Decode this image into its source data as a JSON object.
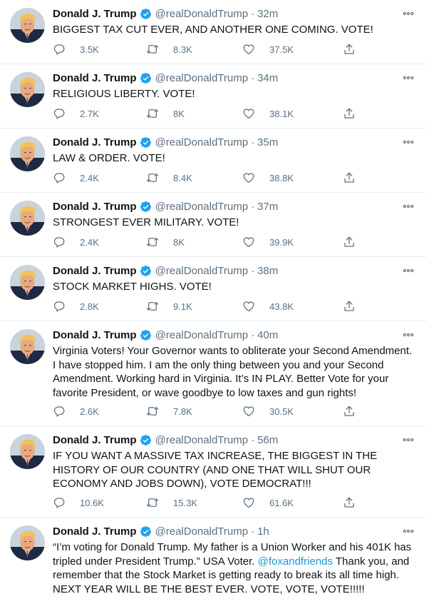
{
  "author": {
    "name": "Donald J. Trump",
    "handle": "@realDonaldTrump",
    "separator": "·"
  },
  "tweets": [
    {
      "time": "32m",
      "text": "BIGGEST TAX CUT EVER, AND ANOTHER ONE COMING. VOTE!",
      "replies": "3.5K",
      "retweets": "8.3K",
      "likes": "37.5K"
    },
    {
      "time": "34m",
      "text": "RELIGIOUS LIBERTY. VOTE!",
      "replies": "2.7K",
      "retweets": "8K",
      "likes": "38.1K"
    },
    {
      "time": "35m",
      "text": "LAW & ORDER. VOTE!",
      "replies": "2.4K",
      "retweets": "8.4K",
      "likes": "38.8K"
    },
    {
      "time": "37m",
      "text": "STRONGEST EVER MILITARY. VOTE!",
      "replies": "2.4K",
      "retweets": "8K",
      "likes": "39.9K"
    },
    {
      "time": "38m",
      "text": "STOCK MARKET HIGHS. VOTE!",
      "replies": "2.8K",
      "retweets": "9.1K",
      "likes": "43.8K"
    },
    {
      "time": "40m",
      "text": "Virginia Voters! Your Governor wants to obliterate your Second Amendment. I have stopped him. I am the only thing between you and your Second Amendment. Working hard in Virginia. It’s IN PLAY. Better Vote for your favorite President, or wave goodbye to low taxes and gun rights!",
      "replies": "2.6K",
      "retweets": "7.8K",
      "likes": "30.5K"
    },
    {
      "time": "56m",
      "text": "IF YOU WANT A MASSIVE TAX INCREASE, THE BIGGEST IN THE HISTORY OF OUR COUNTRY (AND ONE THAT WILL SHUT OUR ECONOMY AND JOBS DOWN), VOTE DEMOCRAT!!!",
      "replies": "10.6K",
      "retweets": "15.3K",
      "likes": "61.6K"
    },
    {
      "time": "1h",
      "text_before": "“I’m voting for Donald Trump. My father is a Union Worker and his 401K has tripled under President Trump.” USA Voter. ",
      "mention": "@foxandfriends",
      "text_after": "  Thank you, and remember that the Stock Market is getting ready to break its all time high. NEXT YEAR WILL BE THE BEST EVER. VOTE, VOTE, VOTE!!!!!"
    }
  ],
  "icons": {
    "verified": "verified-badge-icon",
    "more": "more-options-icon",
    "reply": "reply-icon",
    "retweet": "retweet-icon",
    "like": "heart-icon",
    "share": "share-icon"
  },
  "colors": {
    "verified": "#1da1f2",
    "mention": "#1b95e0",
    "secondary_text": "#5b7083",
    "divider": "#e6ecf0"
  }
}
